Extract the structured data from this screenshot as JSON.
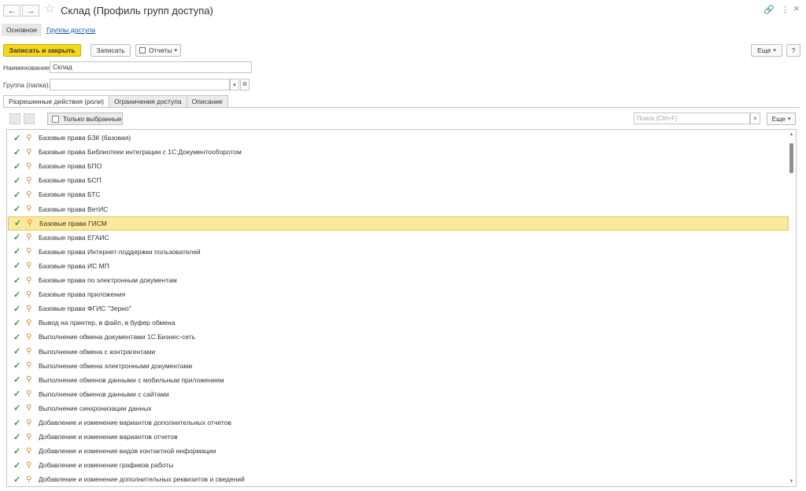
{
  "window": {
    "title": "Склад (Профиль групп доступа)",
    "back_icon": "←",
    "forward_icon": "→",
    "favorite_icon": "☆",
    "link_icon": "🔗",
    "more_icon": "⋮",
    "close_icon": "×"
  },
  "section_nav": {
    "main": "Основное",
    "groups": "Группы доступа"
  },
  "toolbar": {
    "save_close": "Записать и закрыть",
    "save": "Записать",
    "reports": "Отчеты",
    "more": "Еще",
    "help": "?"
  },
  "form": {
    "name_label": "Наименование:",
    "name_value": "Склад",
    "group_label": "Группа (папка):",
    "group_value": ""
  },
  "tabs": [
    "Разрешенные действия (роли)",
    "Ограничения доступа",
    "Описание"
  ],
  "list_toolbar": {
    "only_selected": "Только выбранные",
    "search_placeholder": "Поиск (Ctrl+F)",
    "clear": "×",
    "more": "Еще"
  },
  "roles": [
    "Базовые права БЗК (базовая)",
    "Базовые права Библиотеки интеграции с 1С:Документооборотом",
    "Базовые права БПО",
    "Базовые права БСП",
    "Базовые права БТС",
    "Базовые права ВетИС",
    "Базовые права ГИСМ",
    "Базовые права ЕГАИС",
    "Базовые права Интернет-поддержки пользователей",
    "Базовые права ИС МП",
    "Базовые права по электронным документам",
    "Базовые права приложения",
    "Базовые права ФГИС \"Зерно\"",
    "Вывод на принтер, в файл, в буфер обмена",
    "Выполнение обмена документами 1С:Бизнес-сеть",
    "Выполнение обмена с контрагентами",
    "Выполнение обмена электронными документами",
    "Выполнение обменов данными с мобильным приложением",
    "Выполнение обменов данными с сайтами",
    "Выполнение синхронизации данных",
    "Добавление и изменение вариантов дополнительных отчетов",
    "Добавление и изменение вариантов отчетов",
    "Добавление и изменение видов контактной информации",
    "Добавление и изменение графиков работы",
    "Добавление и изменение дополнительных реквизитов и сведений"
  ],
  "selected_role": "Базовые права ГИСМ",
  "colors": {
    "accent": "#f6d71c",
    "selected_row": "#fbe99b",
    "check": "#2d9a35",
    "key": "#d9872a",
    "link": "#0b4fa7"
  }
}
